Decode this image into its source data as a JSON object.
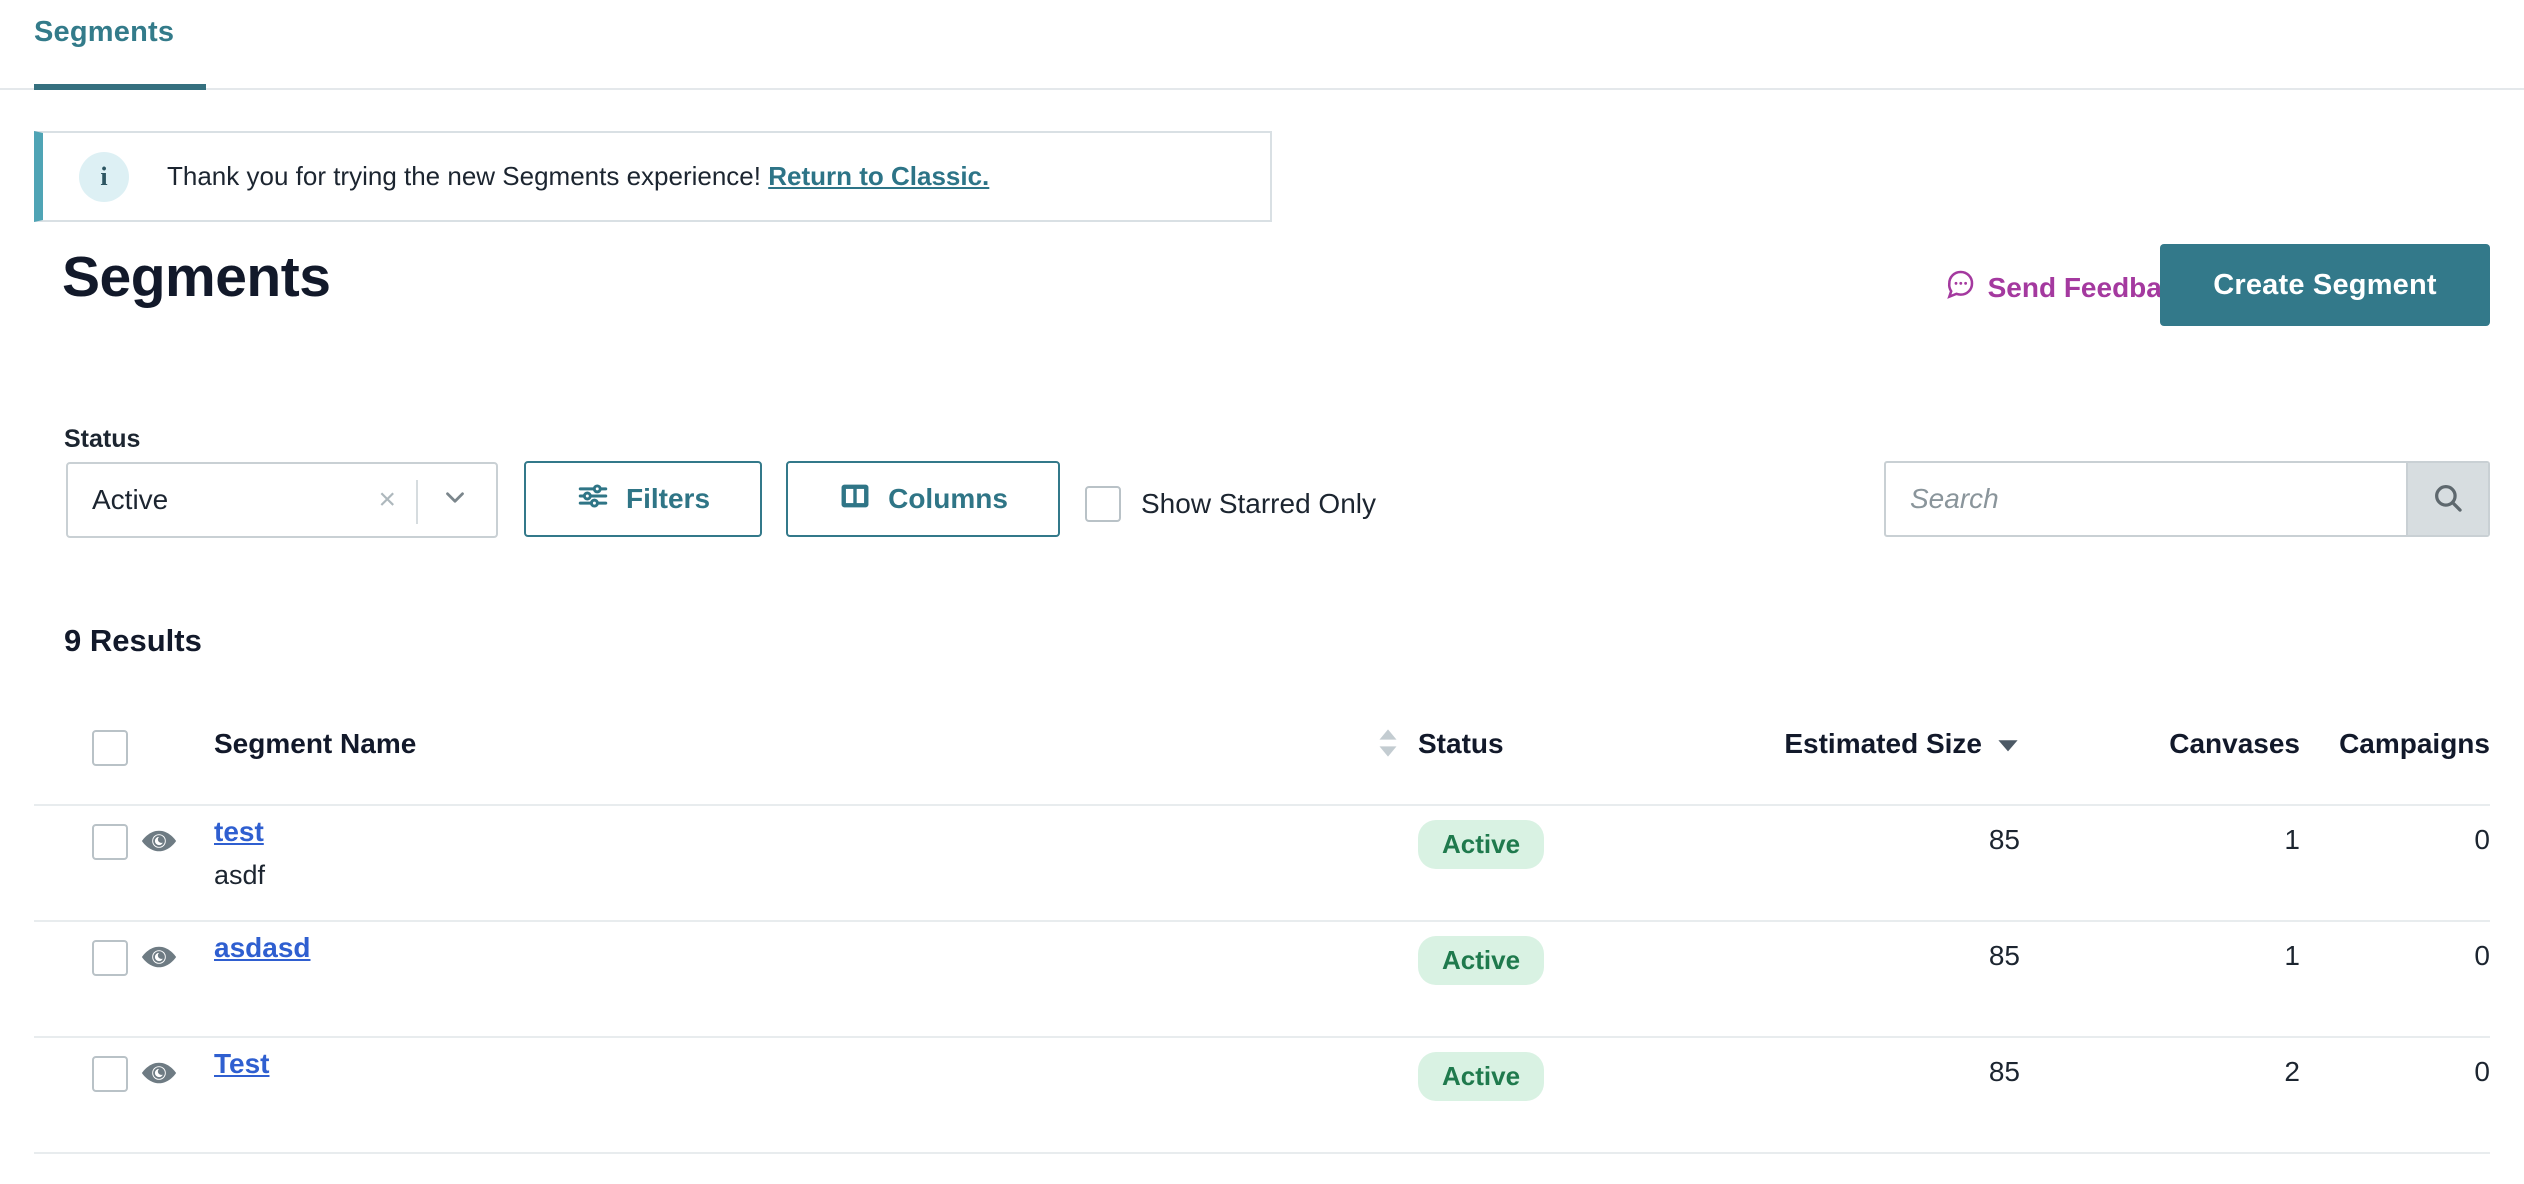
{
  "tabs": [
    {
      "label": "Segments",
      "active": true
    }
  ],
  "banner": {
    "icon": "info-icon",
    "icon_glyph": "i",
    "text": "Thank you for trying the new Segments experience!",
    "link_label": "Return to Classic.",
    "accent_color": "#4fa4b5"
  },
  "header": {
    "title": "Segments",
    "feedback_label": "Send Feedback",
    "feedback_icon": "chat-bubble-icon",
    "feedback_color": "#a4399f",
    "create_label": "Create Segment",
    "create_color": "#33798a"
  },
  "controls": {
    "status_label": "Status",
    "status_value": "Active",
    "clear_glyph": "×",
    "filters_label": "Filters",
    "filters_icon": "sliders-icon",
    "columns_label": "Columns",
    "columns_icon": "columns-icon",
    "starred_label": "Show Starred Only",
    "starred_checked": false,
    "search_placeholder": "Search",
    "search_value": "",
    "search_icon": "search-icon"
  },
  "results": {
    "count_label": "9 Results",
    "columns": {
      "select_all": "",
      "name": "Segment Name",
      "status": "Status",
      "size": "Estimated Size",
      "canvases": "Canvases",
      "campaigns": "Campaigns"
    },
    "sort": {
      "name_state": "none",
      "size_state": "desc"
    },
    "rows": [
      {
        "name": "test",
        "description": "asdf",
        "status": "Active",
        "estimated_size": "85",
        "canvases": "1",
        "campaigns": "0",
        "checked": false
      },
      {
        "name": "asdasd",
        "description": "",
        "status": "Active",
        "estimated_size": "85",
        "canvases": "1",
        "campaigns": "0",
        "checked": false
      },
      {
        "name": "Test",
        "description": "",
        "status": "Active",
        "estimated_size": "85",
        "canvases": "2",
        "campaigns": "0",
        "checked": false
      }
    ]
  },
  "colors": {
    "teal": "#33798a",
    "tab_teal": "#337b8a",
    "link_blue": "#2f5fd0",
    "badge_bg": "#d9f2e3",
    "badge_text": "#1f7a4d",
    "magenta": "#a4399f"
  }
}
